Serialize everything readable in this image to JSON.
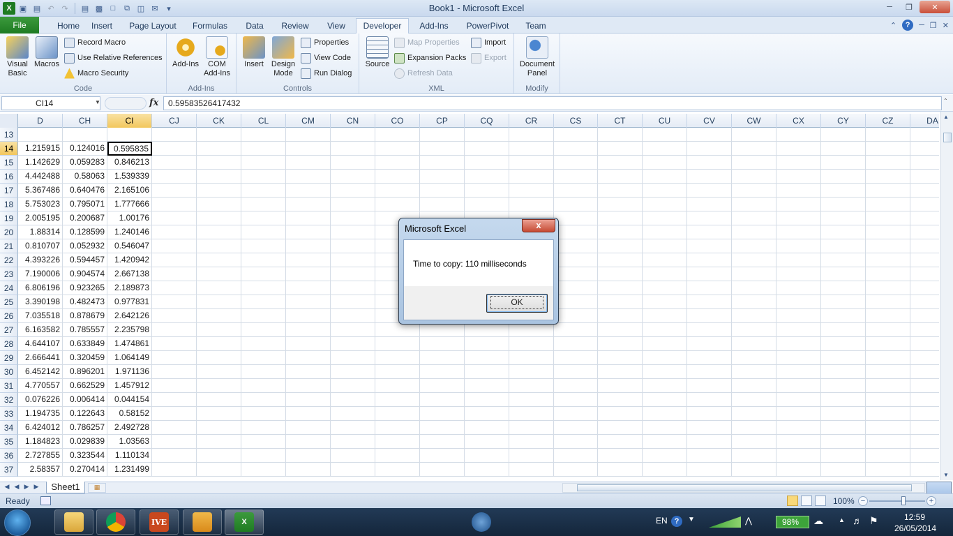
{
  "window": {
    "title": "Book1 - Microsoft Excel"
  },
  "tabs": [
    {
      "label": "File"
    },
    {
      "label": "Home"
    },
    {
      "label": "Insert"
    },
    {
      "label": "Page Layout"
    },
    {
      "label": "Formulas"
    },
    {
      "label": "Data"
    },
    {
      "label": "Review"
    },
    {
      "label": "View"
    },
    {
      "label": "Developer"
    },
    {
      "label": "Add-Ins"
    },
    {
      "label": "PowerPivot"
    },
    {
      "label": "Team"
    }
  ],
  "ribbon": {
    "code": {
      "label": "Code",
      "visual_basic": "Visual Basic",
      "macros": "Macros",
      "record_macro": "Record Macro",
      "relative_refs": "Use Relative References",
      "macro_security": "Macro Security"
    },
    "addins": {
      "label": "Add-Ins",
      "addins": "Add-Ins",
      "com_addins": "COM Add-Ins"
    },
    "controls": {
      "label": "Controls",
      "insert": "Insert",
      "design_mode": "Design Mode",
      "properties": "Properties",
      "view_code": "View Code",
      "run_dialog": "Run Dialog"
    },
    "xml": {
      "label": "XML",
      "source": "Source",
      "map_properties": "Map Properties",
      "expansion_packs": "Expansion Packs",
      "refresh_data": "Refresh Data",
      "import": "Import",
      "export": "Export"
    },
    "modify": {
      "label": "Modify",
      "document_panel": "Document Panel"
    }
  },
  "formula_bar": {
    "name_box": "CI14",
    "fx": "fx",
    "formula": "0.59583526417432"
  },
  "columns": [
    "D",
    "CH",
    "CI",
    "CJ",
    "CK",
    "CL",
    "CM",
    "CN",
    "CO",
    "CP",
    "CQ",
    "CR",
    "CS",
    "CT",
    "CU",
    "CV",
    "CW",
    "CX",
    "CY",
    "CZ",
    "DA"
  ],
  "rows": [
    {
      "n": "13",
      "d": "",
      "ch": "",
      "ci": ""
    },
    {
      "n": "14",
      "d": "1.215915",
      "ch": "0.124016",
      "ci": "0.595835"
    },
    {
      "n": "15",
      "d": "1.142629",
      "ch": "0.059283",
      "ci": "0.846213"
    },
    {
      "n": "16",
      "d": "4.442488",
      "ch": "0.58063",
      "ci": "1.539339"
    },
    {
      "n": "17",
      "d": "5.367486",
      "ch": "0.640476",
      "ci": "2.165106"
    },
    {
      "n": "18",
      "d": "5.753023",
      "ch": "0.795071",
      "ci": "1.777666"
    },
    {
      "n": "19",
      "d": "2.005195",
      "ch": "0.200687",
      "ci": "1.00176"
    },
    {
      "n": "20",
      "d": "1.88314",
      "ch": "0.128599",
      "ci": "1.240146"
    },
    {
      "n": "21",
      "d": "0.810707",
      "ch": "0.052932",
      "ci": "0.546047"
    },
    {
      "n": "22",
      "d": "4.393226",
      "ch": "0.594457",
      "ci": "1.420942"
    },
    {
      "n": "23",
      "d": "7.190006",
      "ch": "0.904574",
      "ci": "2.667138"
    },
    {
      "n": "24",
      "d": "6.806196",
      "ch": "0.923265",
      "ci": "2.189873"
    },
    {
      "n": "25",
      "d": "3.390198",
      "ch": "0.482473",
      "ci": "0.977831"
    },
    {
      "n": "26",
      "d": "7.035518",
      "ch": "0.878679",
      "ci": "2.642126"
    },
    {
      "n": "27",
      "d": "6.163582",
      "ch": "0.785557",
      "ci": "2.235798"
    },
    {
      "n": "28",
      "d": "4.644107",
      "ch": "0.633849",
      "ci": "1.474861"
    },
    {
      "n": "29",
      "d": "2.666441",
      "ch": "0.320459",
      "ci": "1.064149"
    },
    {
      "n": "30",
      "d": "6.452142",
      "ch": "0.896201",
      "ci": "1.971136"
    },
    {
      "n": "31",
      "d": "4.770557",
      "ch": "0.662529",
      "ci": "1.457912"
    },
    {
      "n": "32",
      "d": "0.076226",
      "ch": "0.006414",
      "ci": "0.044154"
    },
    {
      "n": "33",
      "d": "1.194735",
      "ch": "0.122643",
      "ci": "0.58152"
    },
    {
      "n": "34",
      "d": "6.424012",
      "ch": "0.786257",
      "ci": "2.492728"
    },
    {
      "n": "35",
      "d": "1.184823",
      "ch": "0.029839",
      "ci": "1.03563"
    },
    {
      "n": "36",
      "d": "2.727855",
      "ch": "0.323544",
      "ci": "1.110134"
    },
    {
      "n": "37",
      "d": "2.58357",
      "ch": "0.270414",
      "ci": "1.231499"
    }
  ],
  "sheets": [
    {
      "label": "Sheet1"
    }
  ],
  "status": {
    "ready": "Ready",
    "zoom": "100%"
  },
  "dialog": {
    "title": "Microsoft Excel",
    "message": "Time to copy: 110 milliseconds",
    "ok": "OK",
    "close": "x"
  },
  "taskbar": {
    "lang": "EN",
    "battery": "98%",
    "time": "12:59",
    "date": "26/05/2014",
    "ive_label": "IVE"
  }
}
